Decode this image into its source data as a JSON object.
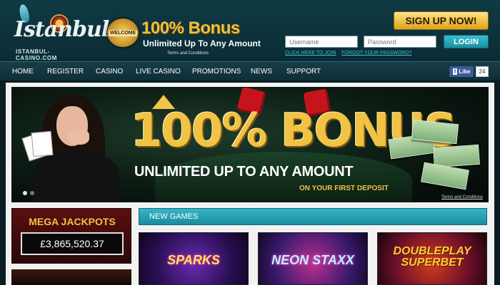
{
  "header": {
    "logo": {
      "script": "Istanbul",
      "domain": "ISTANBUL-CASINO.COM"
    },
    "promo": {
      "badge": "WELCOME",
      "title": "100% Bonus",
      "subtitle": "Unlimited Up To Any Amount",
      "terms": "Terms and Conditions"
    },
    "signup_label": "SIGN UP NOW!",
    "username_placeholder": "Username",
    "password_placeholder": "Password",
    "login_label": "LOGIN",
    "links": {
      "join": "CLICK HERE TO JOIN",
      "forgot": "FORGOT YOUR PASSWORD?"
    }
  },
  "nav": {
    "items": [
      "HOME",
      "REGISTER",
      "CASINO",
      "LIVE CASINO",
      "PROMOTIONS",
      "NEWS",
      "SUPPORT"
    ],
    "facebook": {
      "label": "Like",
      "count": "24"
    }
  },
  "hero": {
    "headline": "100% BONUS",
    "subline": "UNLIMITED UP TO ANY AMOUNT",
    "tagline": "ON YOUR FIRST DEPOSIT",
    "terms": "Terms and Conditions"
  },
  "jackpot": {
    "title": "MEGA JACKPOTS",
    "amount": "£3,865,520.37"
  },
  "new_games": {
    "title": "NEW GAMES",
    "games": [
      "SPARKS",
      "NEON STAXX",
      "DOUBLEPLAY SUPERBET"
    ]
  },
  "colors": {
    "accent_gold": "#f1c243",
    "accent_teal": "#35b6c8",
    "jackpot_red": "#5a0f10"
  }
}
